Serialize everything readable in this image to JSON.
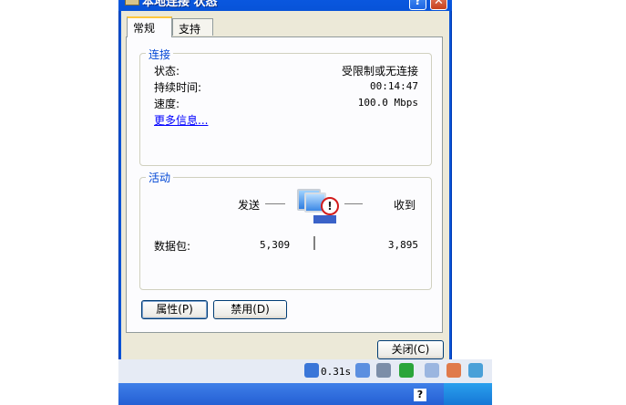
{
  "window": {
    "title": "本地连接 状态",
    "help_label": "?",
    "close_label": "✕"
  },
  "tabs": [
    {
      "label": "常规"
    },
    {
      "label": "支持"
    }
  ],
  "connection": {
    "legend": "连接",
    "status_label": "状态:",
    "status_value": "受限制或无连接",
    "duration_label": "持续时间:",
    "duration_value": "00:14:47",
    "speed_label": "速度:",
    "speed_value": "100.0 Mbps",
    "more_info": "更多信息..."
  },
  "activity": {
    "legend": "活动",
    "sent_label": "发送",
    "received_label": "收到",
    "packets_label": "数据包:",
    "packets_sent": "5,309",
    "packets_received": "3,895"
  },
  "buttons": {
    "properties": "属性(P)",
    "disable": "禁用(D)",
    "close": "关闭(C)"
  },
  "tray": {
    "speed_text": "0.31s"
  },
  "taskbar": {
    "help_text": "?"
  },
  "colors": {
    "title_blue": "#0a58e0",
    "legend_blue": "#0046d5",
    "link_blue": "#0000ff",
    "warning_red": "#d21c1c"
  },
  "icons": [
    "network-status-icon",
    "help-icon",
    "close-icon",
    "computer-icon",
    "warning-icon",
    "tray-icons"
  ]
}
